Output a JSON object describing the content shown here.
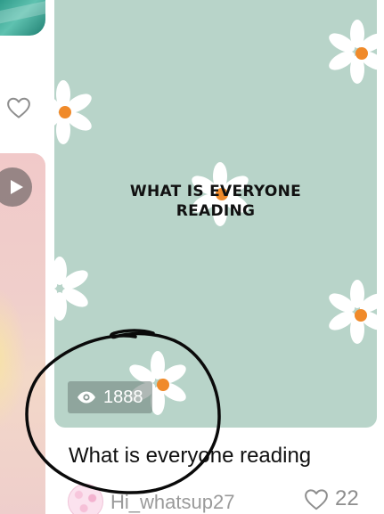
{
  "card": {
    "image_title_line1": "WHAT IS EVERYONE",
    "image_title_line2": "READING",
    "views": "1888",
    "caption": "What is everyone reading",
    "author": "Hi_whatsup27",
    "likes": "22",
    "background_color": "#b8d4c9"
  },
  "icons": {
    "views": "eye-icon",
    "likes": "heart-outline-icon",
    "left_likes": "heart-outline-icon",
    "left_play": "play-icon"
  }
}
